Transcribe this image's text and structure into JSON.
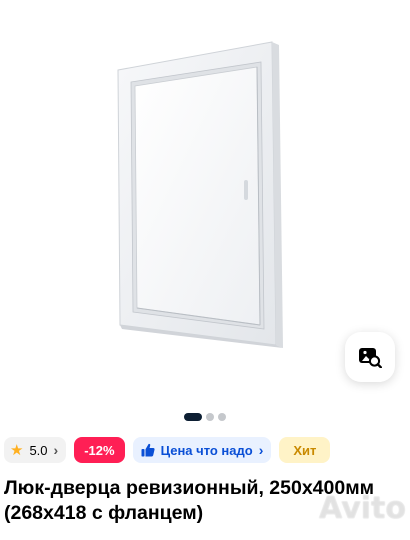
{
  "listing": {
    "rating": "5.0",
    "discount": "-12%",
    "price_badge": "Цена что надо",
    "hit_badge": "Хит",
    "title": "Люк-дверца ревизионный, 250x400мм (268x418 с фланцем)",
    "watermark": "Avito"
  },
  "gallery": {
    "total_images": 3,
    "active_index": 0
  },
  "icons": {
    "visual_search": "image-search-icon",
    "rating": "star-icon",
    "price_badge": "thumbs-up-icon",
    "chevron": "chevron-right-icon"
  },
  "colors": {
    "star": "#ffb021",
    "discount_bg": "#ff1f55",
    "price_badge_bg": "#e9f1ff",
    "price_badge_text": "#0a4fd6",
    "hit_bg": "#fff3c7",
    "hit_text": "#c98a00",
    "pager_active": "#0d1f33"
  }
}
